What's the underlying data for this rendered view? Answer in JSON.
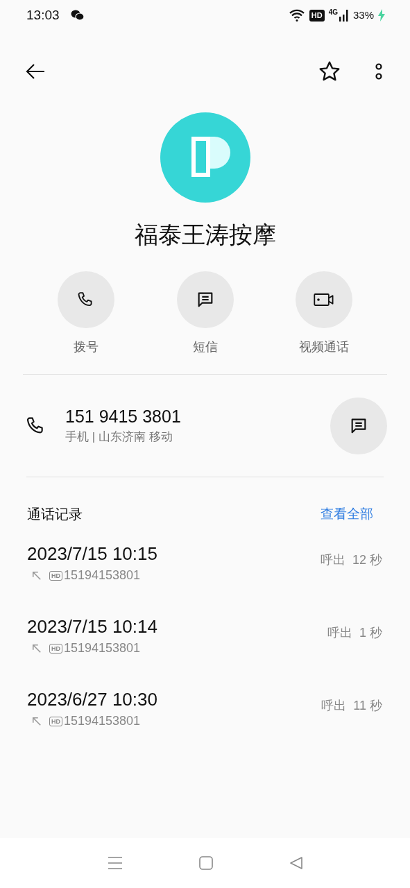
{
  "status_bar": {
    "time": "13:03",
    "hd": "HD",
    "network": "4G",
    "battery": "33%"
  },
  "contact": {
    "name": "福泰王涛按摩"
  },
  "actions": [
    {
      "kind": "call",
      "label": "拨号"
    },
    {
      "kind": "message",
      "label": "短信"
    },
    {
      "kind": "video",
      "label": "视频通话"
    }
  ],
  "phone": {
    "number": "151 9415 3801",
    "detail": "手机 | 山东济南 移动"
  },
  "call_log": {
    "title": "通话记录",
    "view_all": "查看全部",
    "entries": [
      {
        "datetime": "2023/7/15 10:15",
        "hd": "HD",
        "number": "15194153801",
        "direction": "呼出",
        "duration": "12 秒"
      },
      {
        "datetime": "2023/7/15 10:14",
        "hd": "HD",
        "number": "15194153801",
        "direction": "呼出",
        "duration": "1 秒"
      },
      {
        "datetime": "2023/6/27 10:30",
        "hd": "HD",
        "number": "15194153801",
        "direction": "呼出",
        "duration": "11 秒"
      }
    ]
  }
}
